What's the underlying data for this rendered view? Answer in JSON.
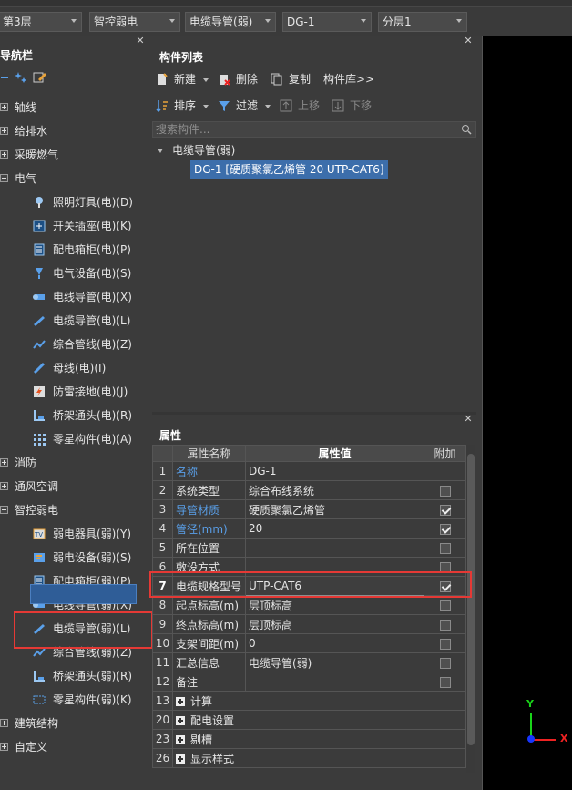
{
  "toolbar": {
    "floor": "第3层",
    "system": "智控弱电",
    "category": "电缆导管(弱)",
    "component": "DG-1",
    "layer": "分层1"
  },
  "nav": {
    "title": "导航栏",
    "groups": [
      {
        "label": "轴线"
      },
      {
        "label": "给排水"
      },
      {
        "label": "采暖燃气"
      },
      {
        "label": "电气"
      },
      {
        "label": "消防"
      },
      {
        "label": "通风空调"
      },
      {
        "label": "智控弱电"
      },
      {
        "label": "建筑结构"
      },
      {
        "label": "自定义"
      }
    ],
    "electric_items": [
      {
        "label": "照明灯具(电)(D)",
        "icon": "lamp-icon"
      },
      {
        "label": "开关插座(电)(K)",
        "icon": "switch-socket-icon"
      },
      {
        "label": "配电箱柜(电)(P)",
        "icon": "distribution-box-icon"
      },
      {
        "label": "电气设备(电)(S)",
        "icon": "electrical-device-icon"
      },
      {
        "label": "电线导管(电)(X)",
        "icon": "wire-conduit-icon"
      },
      {
        "label": "电缆导管(电)(L)",
        "icon": "cable-conduit-icon"
      },
      {
        "label": "综合管线(电)(Z)",
        "icon": "combined-pipeline-icon"
      },
      {
        "label": "母线(电)(I)",
        "icon": "busbar-icon"
      },
      {
        "label": "防雷接地(电)(J)",
        "icon": "lightning-ground-icon"
      },
      {
        "label": "桥架通头(电)(R)",
        "icon": "tray-fitting-icon"
      },
      {
        "label": "零星构件(电)(A)",
        "icon": "misc-component-icon"
      }
    ],
    "weak_items": [
      {
        "label": "弱电器具(弱)(Y)",
        "icon": "weak-appliance-icon"
      },
      {
        "label": "弱电设备(弱)(S)",
        "icon": "weak-device-icon"
      },
      {
        "label": "配电箱柜(弱)(P)",
        "icon": "distribution-box-icon"
      },
      {
        "label": "电线导管(弱)(X)",
        "icon": "wire-conduit-icon"
      },
      {
        "label": "电缆导管(弱)(L)",
        "icon": "cable-conduit-icon"
      },
      {
        "label": "综合管线(弱)(Z)",
        "icon": "combined-pipeline-icon"
      },
      {
        "label": "桥架通头(弱)(R)",
        "icon": "tray-fitting-icon"
      },
      {
        "label": "零星构件(弱)(K)",
        "icon": "misc-component-icon"
      }
    ]
  },
  "component_list": {
    "title": "构件列表",
    "new": "新建",
    "delete": "删除",
    "copy": "复制",
    "library": "构件库>>",
    "sort": "排序",
    "filter": "过滤",
    "move_up": "上移",
    "move_down": "下移",
    "search_placeholder": "搜索构件...",
    "tree_parent": "电缆导管(弱)",
    "tree_child": "DG-1 [硬质聚氯乙烯管 20 UTP-CAT6]"
  },
  "properties": {
    "title": "属性",
    "col_name": "属性名称",
    "col_value": "属性值",
    "col_extra": "附加",
    "rows": [
      {
        "num": "1",
        "name": "名称",
        "value": "DG-1",
        "check": "none"
      },
      {
        "num": "2",
        "name": "系统类型",
        "value": "综合布线系统",
        "check": "off"
      },
      {
        "num": "3",
        "name": "导管材质",
        "value": "硬质聚氯乙烯管",
        "check": "on"
      },
      {
        "num": "4",
        "name": "管径(mm)",
        "value": "20",
        "check": "on"
      },
      {
        "num": "5",
        "name": "所在位置",
        "value": "",
        "check": "off"
      },
      {
        "num": "6",
        "name": "敷设方式",
        "value": "",
        "check": "off"
      },
      {
        "num": "7",
        "name": "电缆规格型号",
        "value": "UTP-CAT6",
        "check": "on"
      },
      {
        "num": "8",
        "name": "起点标高(m)",
        "value": "层顶标高",
        "check": "off"
      },
      {
        "num": "9",
        "name": "终点标高(m)",
        "value": "层顶标高",
        "check": "off"
      },
      {
        "num": "10",
        "name": "支架间距(m)",
        "value": "0",
        "check": "off"
      },
      {
        "num": "11",
        "name": "汇总信息",
        "value": "电缆导管(弱)",
        "check": "off"
      },
      {
        "num": "12",
        "name": "备注",
        "value": "",
        "check": "off"
      },
      {
        "num": "13",
        "name": "计算",
        "value": "",
        "check": "none"
      },
      {
        "num": "20",
        "name": "配电设置",
        "value": "",
        "check": "none"
      },
      {
        "num": "23",
        "name": "剔槽",
        "value": "",
        "check": "none"
      },
      {
        "num": "26",
        "name": "显示样式",
        "value": "",
        "check": "none"
      }
    ]
  },
  "axes": {
    "x": "X",
    "y": "Y"
  },
  "colors": {
    "selection": "#2f5d97",
    "highlight_box": "#e53935",
    "blue_label": "#5aa0ea"
  }
}
